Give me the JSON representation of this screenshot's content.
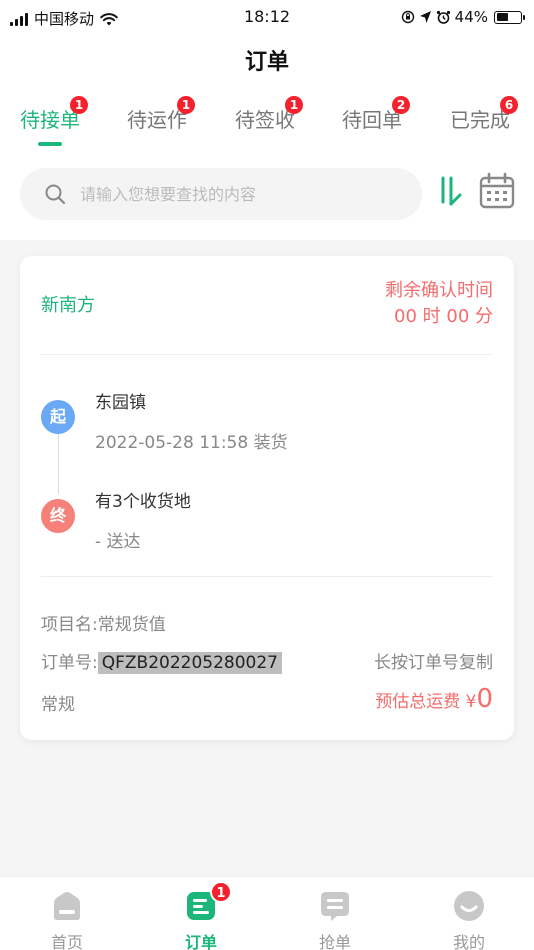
{
  "status_bar": {
    "carrier": "中国移动",
    "time": "18:12",
    "battery": "44%",
    "battery_level": 0.44
  },
  "header": {
    "title": "订单"
  },
  "tabs": [
    {
      "label": "待接单",
      "badge": "1",
      "active": true
    },
    {
      "label": "待运作",
      "badge": "1",
      "active": false
    },
    {
      "label": "待签收",
      "badge": "1",
      "active": false
    },
    {
      "label": "待回单",
      "badge": "2",
      "active": false
    },
    {
      "label": "已完成",
      "badge": "6",
      "active": false
    }
  ],
  "search": {
    "placeholder": "请输入您想要查找的内容",
    "value": ""
  },
  "order": {
    "company": "新南方",
    "remain_label": "剩余确认时间",
    "remain_time": "00 时 00 分",
    "start_badge": "起",
    "start_place": "东园镇",
    "start_detail": "2022-05-28 11:58 装货",
    "end_badge": "终",
    "end_place": "有3个收货地",
    "end_detail": "- 送达",
    "project_label": "项目名:",
    "project_value": "常规货值",
    "order_no_label": "订单号:",
    "order_no": "QFZB202205280027",
    "copy_hint": "长按订单号复制",
    "type": "常规",
    "fee_label": "预估总运费",
    "fee_currency": "¥",
    "fee_amount": "0"
  },
  "bottom_nav": [
    {
      "label": "首页",
      "icon": "home-icon",
      "active": false
    },
    {
      "label": "订单",
      "icon": "order-list-icon",
      "active": true,
      "badge": "1"
    },
    {
      "label": "抢单",
      "icon": "grab-order-icon",
      "active": false
    },
    {
      "label": "我的",
      "icon": "profile-icon",
      "active": false
    }
  ],
  "colors": {
    "accent": "#1db67a",
    "alert": "#f56c6c",
    "badge": "#f5222d",
    "start_dot": "#6ba8f6",
    "end_dot": "#f5817a"
  }
}
